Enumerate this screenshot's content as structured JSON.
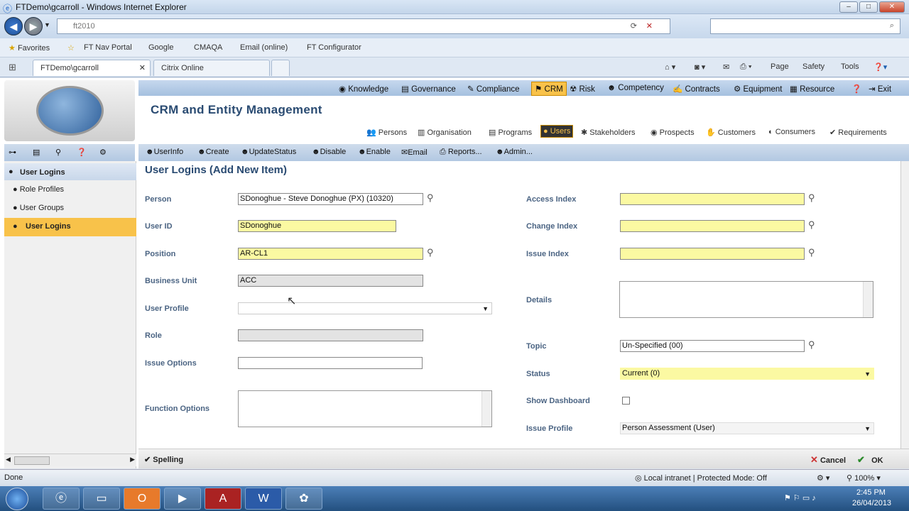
{
  "window": {
    "title": "FTDemo\\gcarroll - Windows Internet Explorer",
    "min": "–",
    "max": "□",
    "close": "✕"
  },
  "browser": {
    "address": "ft2010",
    "favorites_label": "Favorites",
    "favorites": [
      "FT Nav Portal",
      "Google",
      "CMAQA",
      "Email (online)",
      "FT Configurator"
    ],
    "tabs": [
      "FTDemo\\gcarroll",
      "Citrix Online"
    ],
    "commands": [
      "Page",
      "Safety",
      "Tools"
    ]
  },
  "app": {
    "title": "CRM and Entity Management",
    "top_nav": [
      "Knowledge",
      "Governance",
      "Compliance",
      "CRM",
      "Risk",
      "Competency",
      "Contracts",
      "Equipment",
      "Resource",
      "Exit"
    ],
    "sub_nav": [
      "Persons",
      "Organisation",
      "Programs",
      "Users",
      "Stakeholders",
      "Prospects",
      "Customers",
      "Consumers",
      "Requirements"
    ],
    "toolbar": [
      "UserInfo",
      "Create",
      "UpdateStatus",
      "Disable",
      "Enable",
      "Email",
      "Reports...",
      "Admin..."
    ],
    "sidebar": {
      "header": "User Logins",
      "items": [
        "Role Profiles",
        "User Groups",
        "User Logins"
      ]
    },
    "form": {
      "title": "User Logins (Add New Item)",
      "person_label": "Person",
      "person_value": "SDonoghue - Steve Donoghue (PX) (10320)",
      "userid_label": "User ID",
      "userid_value": "SDonoghue",
      "position_label": "Position",
      "position_value": "AR-CL1",
      "bu_label": "Business Unit",
      "bu_value": "ACC",
      "profile_label": "User Profile",
      "profile_value": "",
      "role_label": "Role",
      "role_value": "",
      "issueopt_label": "Issue Options",
      "issueopt_value": "",
      "funcopt_label": "Function Options",
      "access_label": "Access Index",
      "change_label": "Change Index",
      "issueidx_label": "Issue Index",
      "details_label": "Details",
      "topic_label": "Topic",
      "topic_value": "Un-Specified (00)",
      "status_label": "Status",
      "status_value": "Current (0)",
      "dash_label": "Show Dashboard",
      "issueprof_label": "Issue Profile",
      "issueprof_value": "Person Assessment (User)"
    },
    "bottom": {
      "spelling": "Spelling",
      "cancel": "Cancel",
      "ok": "OK"
    }
  },
  "statusbar": {
    "left": "Done",
    "zone": "Local intranet | Protected Mode: Off",
    "zoom": "100%"
  },
  "taskbar": {
    "time": "2:45 PM",
    "date": "26/04/2013"
  }
}
